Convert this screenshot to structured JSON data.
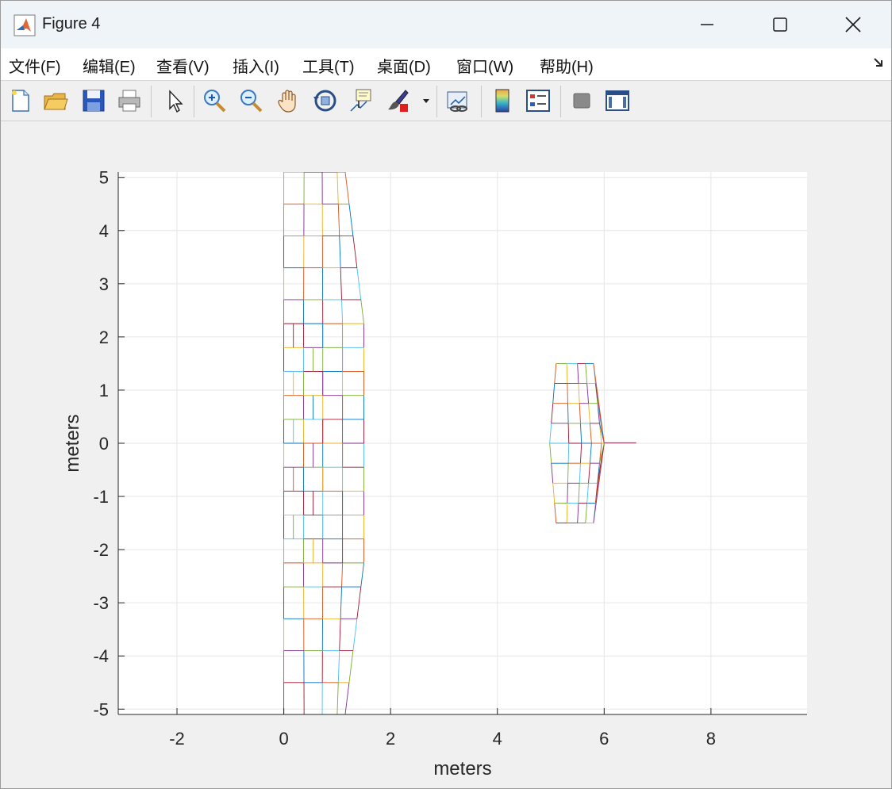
{
  "window": {
    "title": "Figure 4",
    "minimize_icon": "minimize-icon",
    "maximize_icon": "maximize-icon",
    "close_icon": "close-icon"
  },
  "menu": {
    "items": [
      "文件(F)",
      "编辑(E)",
      "查看(V)",
      "插入(I)",
      "工具(T)",
      "桌面(D)",
      "窗口(W)",
      "帮助(H)"
    ],
    "dock_icon": "dock-arrow-icon"
  },
  "toolbar": {
    "icons": [
      "new-figure-icon",
      "open-file-icon",
      "save-icon",
      "print-icon",
      "select-arrow-icon",
      "zoom-in-icon",
      "zoom-out-icon",
      "pan-hand-icon",
      "rotate-3d-icon",
      "data-cursor-icon",
      "brush-icon",
      "brush-dropdown-icon",
      "link-plot-icon",
      "colorbar-icon",
      "legend-icon",
      "hide-plot-tools-icon",
      "show-plot-tools-icon"
    ]
  },
  "chart_data": {
    "type": "line",
    "title": "",
    "xlabel": "meters",
    "ylabel": "meters",
    "xlim": [
      -3.1,
      9.8
    ],
    "ylim": [
      -5.1,
      5.1
    ],
    "xticks": [
      "-2",
      "0",
      "2",
      "4",
      "6",
      "8"
    ],
    "yticks": [
      "5",
      "4",
      "3",
      "2",
      "1",
      "0",
      "-1",
      "-2",
      "-3",
      "-4",
      "-5"
    ],
    "xtick_values": [
      -2,
      0,
      2,
      4,
      6,
      8
    ],
    "ytick_values": [
      5,
      4,
      3,
      2,
      1,
      0,
      -1,
      -2,
      -3,
      -4,
      -5
    ],
    "grid": true,
    "series_colors": [
      "#0072BD",
      "#D95319",
      "#EDB120",
      "#7E2F8E",
      "#77AC30",
      "#4DBEEE",
      "#A2142F"
    ],
    "left_wall": {
      "center_x_columns": [
        0,
        0.37,
        0.73,
        1.1,
        1.5
      ],
      "inner_band": [
        -2.25,
        2.25
      ],
      "top_taper_x": [
        0,
        0.38,
        0.72,
        1.0,
        1.15
      ],
      "y_rows": [
        -5.1,
        -4.5,
        -3.9,
        -3.3,
        -2.7,
        -2.25,
        -1.8,
        -1.35,
        -0.9,
        -0.45,
        0,
        0.45,
        0.9,
        1.35,
        1.8,
        2.25,
        2.7,
        3.3,
        3.9,
        4.5,
        5.1
      ]
    },
    "right_object": {
      "x_columns": [
        5.1,
        5.3,
        5.5,
        5.65,
        5.8
      ],
      "tip_x": 6.0,
      "stub_x": [
        6.0,
        6.6
      ],
      "y_rows": [
        -1.5,
        -1.125,
        -0.75,
        -0.375,
        0,
        0.375,
        0.75,
        1.125,
        1.5
      ]
    }
  }
}
